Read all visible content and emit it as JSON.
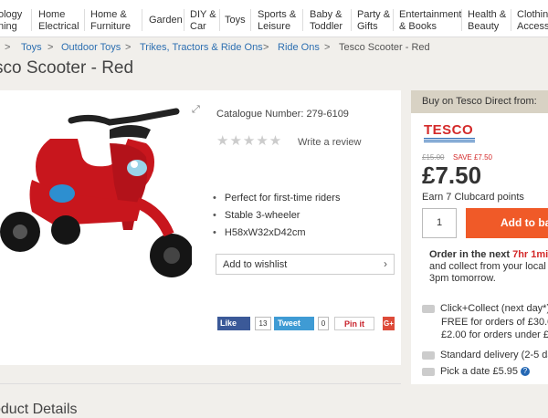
{
  "nav": {
    "items": [
      "ology\nning",
      "Home\nElectrical",
      "Home &\nFurniture",
      "Garden",
      "DIY &\nCar",
      "Toys",
      "Sports &\nLeisure",
      "Baby &\nToddler",
      "Party &\nGifts",
      "Entertainment\n& Books",
      "Health &\nBeauty",
      "Clothing\nAccesso"
    ]
  },
  "breadcrumb": {
    "items": [
      "Toys",
      "Outdoor Toys",
      "Trikes, Tractors & Ride Ons",
      "Ride Ons"
    ],
    "current": "Tesco Scooter - Red",
    "separator": ">"
  },
  "product": {
    "title": "sco Scooter - Red",
    "catalogue": "Catalogue Number: 279-6109",
    "stars": "★★★★★",
    "write_review": "Write a review",
    "features": [
      "Perfect for first-time riders",
      "Stable 3-wheeler",
      "H58xW32xD42cm"
    ],
    "wishlist": "Add to wishlist",
    "expand_icon": "expand-icon",
    "details_heading": "oduct Details"
  },
  "social": {
    "fb_label": "Like",
    "fb_count": "13",
    "tw_label": "Tweet",
    "tw_count": "0",
    "pin_label": "Pin it",
    "gplus_label": "G+"
  },
  "buy": {
    "header": "Buy on Tesco Direct from:",
    "retailer": "TESCO",
    "was_price": "£15.00",
    "save": "SAVE £7.50",
    "price": "£7.50",
    "clubcard": "Earn 7 Clubcard points",
    "quantity": "1",
    "add_to_basket": "Add to bas",
    "order_line1_prefix": "Order in the next",
    "order_timer": "7hr 1min",
    "order_line2": "and collect from your local st",
    "order_line3": "3pm tomorrow.",
    "click_collect": "Click+Collect (next day*)",
    "cc_free": "FREE for orders of £30.00",
    "cc_fee": "£2.00 for orders under £3",
    "standard": "Standard delivery (2-5 day",
    "pick_date": "Pick a date £5.95"
  },
  "colors": {
    "brand_red": "#d42a2a",
    "basket_orange": "#f05a28",
    "link_blue": "#2d6fb1"
  }
}
